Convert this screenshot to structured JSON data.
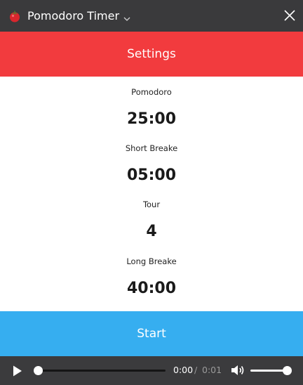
{
  "window": {
    "title": "Pomodoro Timer",
    "app_icon": "tomato-icon",
    "close_icon": "close-icon",
    "dropdown_icon": "chevron-down-icon"
  },
  "header": {
    "settings_label": "Settings"
  },
  "fields": [
    {
      "label": "Pomodoro",
      "value": "25:00"
    },
    {
      "label": "Short Breake",
      "value": "05:00"
    },
    {
      "label": "Tour",
      "value": "4"
    },
    {
      "label": "Long Breake",
      "value": "40:00"
    }
  ],
  "actions": {
    "start_label": "Start"
  },
  "media": {
    "current_time": "0:00",
    "separator": "/",
    "total_time": "0:01",
    "progress": 0,
    "volume": 1.0,
    "play_icon": "play-icon",
    "volume_icon": "volume-icon"
  },
  "colors": {
    "titlebar": "#3a3a3c",
    "settings_bar": "#f23b3e",
    "start_bar": "#36aef0",
    "media_bar": "#3b3b3d"
  }
}
